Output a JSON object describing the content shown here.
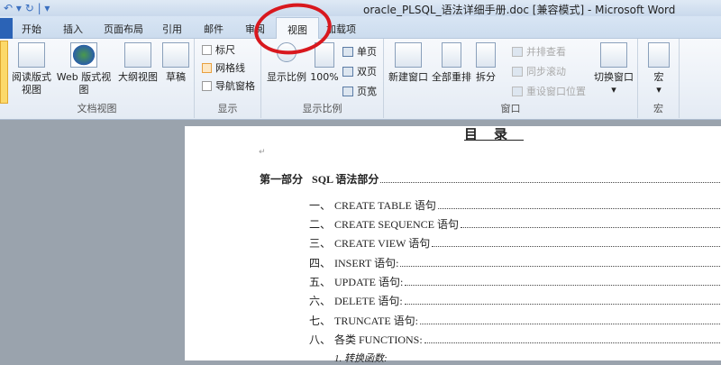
{
  "window": {
    "title": "oracle_PLSQL_语法详细手册.doc [兼容模式] - Microsoft Word",
    "quick_access": "↶ ▾ ↻ | ▾"
  },
  "tabs": [
    "开始",
    "插入",
    "页面布局",
    "引用",
    "邮件",
    "审阅",
    "视图",
    "加载项"
  ],
  "ribbon": {
    "doc_views": {
      "label": "文档视图",
      "items": [
        "阅读版式\n视图",
        "Web 版式视图",
        "大纲视图",
        "草稿"
      ]
    },
    "show": {
      "label": "显示",
      "items": [
        "标尺",
        "网格线",
        "导航窗格"
      ]
    },
    "zoom": {
      "label": "显示比例",
      "zoom": "显示比例",
      "hundred": "100%",
      "single": "单页",
      "double": "双页",
      "width": "页宽"
    },
    "window": {
      "label": "窗口",
      "new": "新建窗口",
      "arrange": "全部重排",
      "split": "拆分",
      "side": "并排查看",
      "sync": "同步滚动",
      "reset": "重设窗口位置",
      "switch": "切换窗口"
    },
    "macro": {
      "label": "宏",
      "item": "宏"
    }
  },
  "document": {
    "heading": "目录",
    "part": {
      "num": "第一部分",
      "text": "SQL 语法部分"
    },
    "items": [
      {
        "num": "一、",
        "text": "CREATE TABLE 语句"
      },
      {
        "num": "二、",
        "text": "CREATE SEQUENCE 语句"
      },
      {
        "num": "三、",
        "text": "CREATE VIEW 语句"
      },
      {
        "num": "四、",
        "text": "INSERT 语句:"
      },
      {
        "num": "五、",
        "text": "UPDATE 语句:"
      },
      {
        "num": "六、",
        "text": "DELETE 语句:"
      },
      {
        "num": "七、",
        "text": "TRUNCATE 语句:"
      },
      {
        "num": "八、",
        "text": "各类 FUNCTIONS:"
      }
    ],
    "sub": "1. 转换函数:"
  }
}
